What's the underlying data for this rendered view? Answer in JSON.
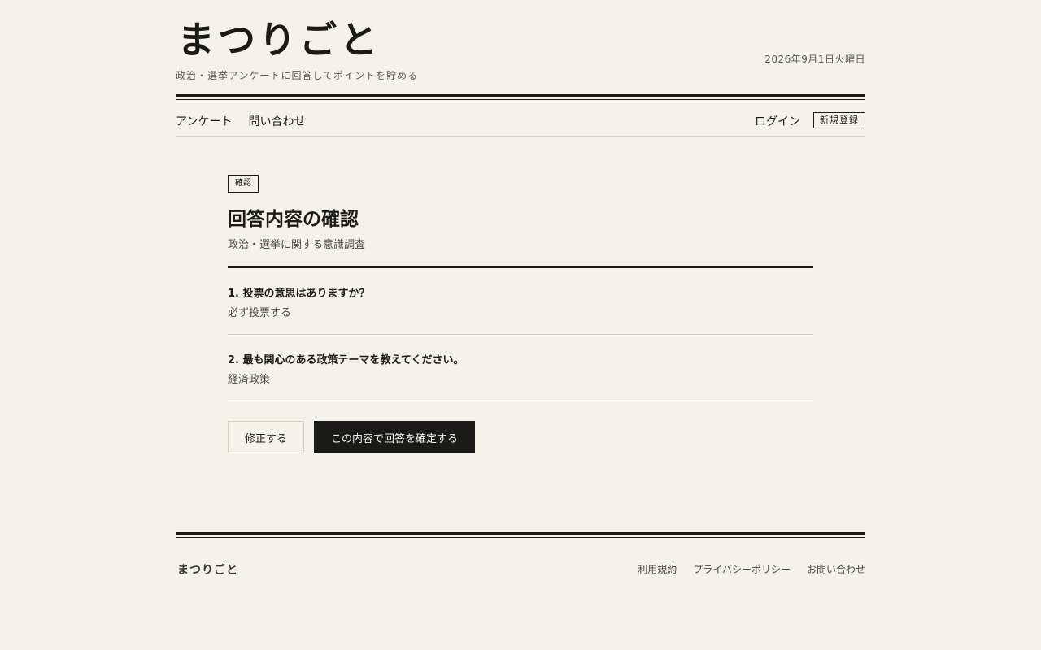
{
  "header": {
    "logo": "まつりごと",
    "tagline": "政治・選挙アンケートに回答してポイントを貯める",
    "date": "2026年9月1日火曜日"
  },
  "nav": {
    "left": [
      "アンケート",
      "問い合わせ"
    ],
    "login": "ログイン",
    "register": "新規登録"
  },
  "main": {
    "badge": "確認",
    "title": "回答内容の確認",
    "survey_name": "政治・選挙に関する意識調査",
    "answers": [
      {
        "question": "1. 投票の意思はありますか？",
        "answer": "必ず投票する"
      },
      {
        "question": "2. 最も関心のある政策テーマを教えてください。",
        "answer": "経済政策"
      }
    ],
    "edit_button": "修正する",
    "confirm_button": "この内容で回答を確定する"
  },
  "footer": {
    "logo": "まつりごと",
    "links": [
      "利用規約",
      "プライバシーポリシー",
      "お問い合わせ"
    ]
  }
}
